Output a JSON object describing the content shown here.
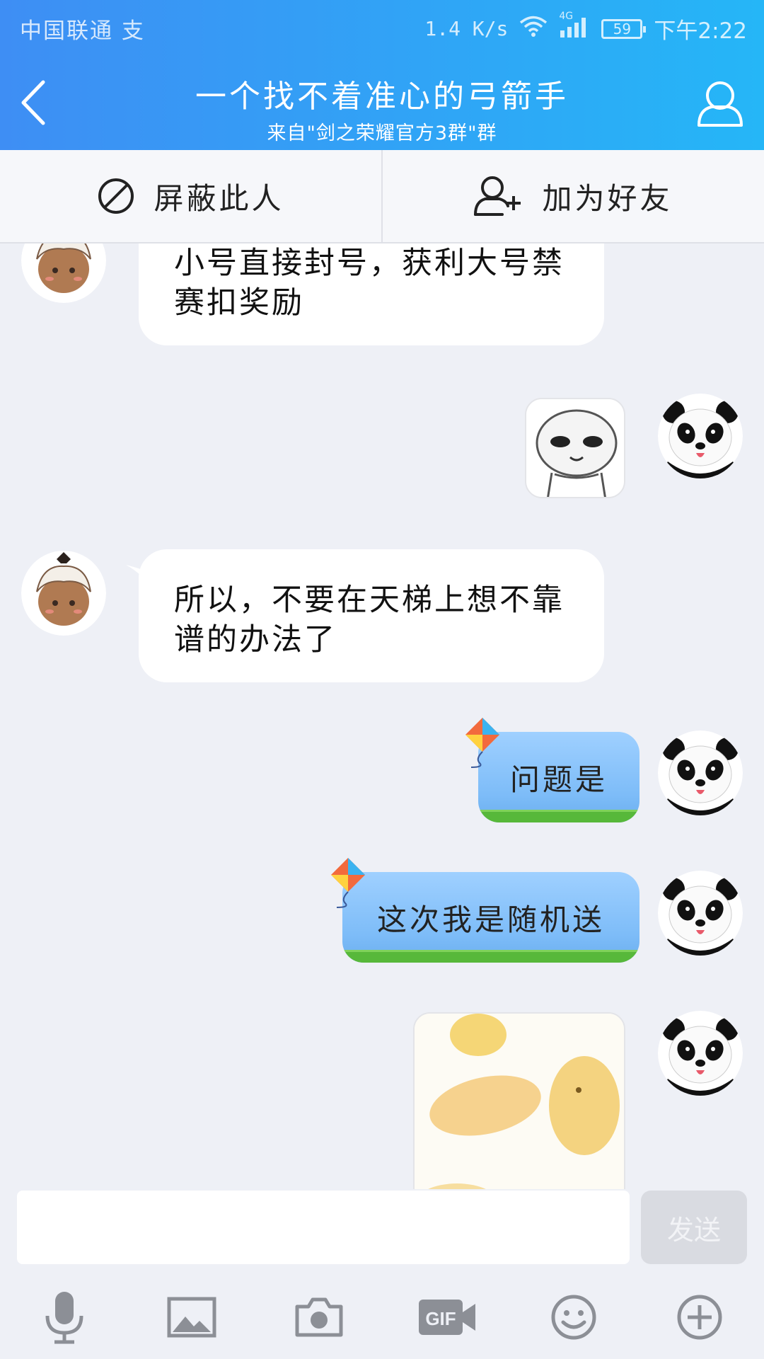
{
  "status_bar": {
    "carrier": "中国联通",
    "carrier_extra": "支",
    "speed": "1.4 K/s",
    "network": "4G",
    "battery": "59",
    "time": "下午2:22"
  },
  "header": {
    "title": "一个找不着准心的弓箭手",
    "subtitle": "来自\"剑之荣耀官方3群\"群"
  },
  "actions": {
    "block_label": "屏蔽此人",
    "add_friend_label": "加为好友"
  },
  "messages": [
    {
      "side": "left",
      "type": "text",
      "text_line1": "小号直接封号，获利大号禁",
      "text_line2": "赛扣奖励"
    },
    {
      "side": "right",
      "type": "sticker",
      "sticker": "meme-face"
    },
    {
      "side": "left",
      "type": "text",
      "text_line1": "所以，不要在天梯上想不靠",
      "text_line2": "谱的办法了"
    },
    {
      "side": "right",
      "type": "text",
      "text": "问题是"
    },
    {
      "side": "right",
      "type": "text",
      "text": "这次我是随机送"
    },
    {
      "side": "right",
      "type": "sticker",
      "sticker": "yellow-chicks"
    }
  ],
  "input": {
    "value": "",
    "send_label": "发送"
  },
  "toolbar": {
    "gif_label": "GIF"
  },
  "colors": {
    "header_start": "#3e8ef4",
    "header_end": "#25b6f7",
    "chat_bg": "#eef0f6",
    "bubble_blue": "#7dbcf8"
  }
}
